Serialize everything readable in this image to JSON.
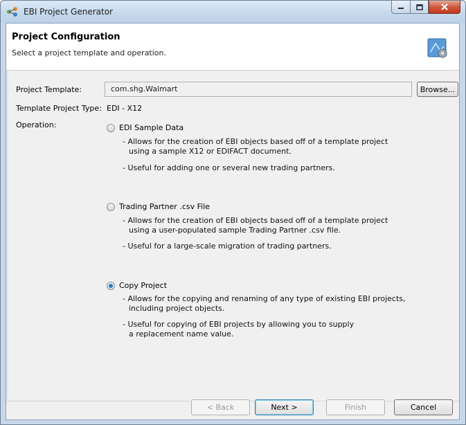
{
  "window": {
    "title": "EBI Project Generator"
  },
  "banner": {
    "title": "Project Configuration",
    "subtitle": "Select a project template and operation."
  },
  "form": {
    "template_label": "Project Template:",
    "template_value": "com.shg.Walmart",
    "browse_label": "Browse...",
    "type_label": "Template Project Type:",
    "type_value": "EDI - X12",
    "operation_label": "Operation:"
  },
  "operations": [
    {
      "label": "EDI Sample Data",
      "checked": false,
      "desc1a": "- Allows for the creation of EBI objects based off of a template project",
      "desc1b": "using a sample X12 or EDIFACT document.",
      "desc2": "- Useful for adding one or several new trading partners."
    },
    {
      "label": "Trading Partner .csv File",
      "checked": false,
      "desc1a": "- Allows for the creation of EBI objects based off of a template project",
      "desc1b": "using a user-populated sample Trading Partner .csv file.",
      "desc2": "- Useful for a large-scale migration of trading partners."
    },
    {
      "label": "Copy Project",
      "checked": true,
      "desc1a": "- Allows for the copying and renaming of any type of existing EBI projects,",
      "desc1b": "including project objects.",
      "desc2a": "- Useful for copying of EBI projects by allowing you to supply",
      "desc2b": "a replacement name value."
    }
  ],
  "buttons": {
    "back": "< Back",
    "next": "Next >",
    "finish": "Finish",
    "cancel": "Cancel"
  },
  "colors": {
    "titlebar": "#c5d8ec",
    "client_bg": "#f0f0f0",
    "close_button": "#c1391c",
    "radio_accent": "#2a7fc7"
  }
}
